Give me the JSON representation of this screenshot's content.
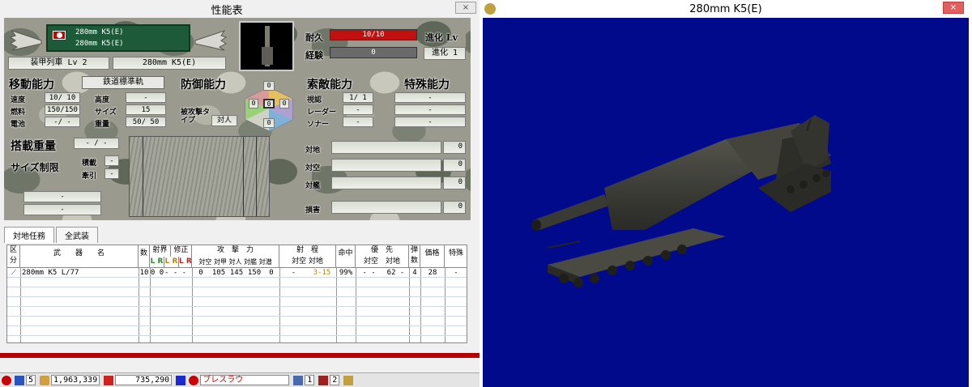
{
  "left_window": {
    "title": "性能表",
    "close_label": "⨯",
    "unit": {
      "name_line1": "280mm K5(E)",
      "name_line2": "280mm K5(E)",
      "class_level": "装甲列車 Lv 2",
      "name_field": "280mm K5(E)"
    },
    "durability": {
      "label": "耐久",
      "value": "10/10"
    },
    "experience": {
      "label": "経験",
      "value": "0"
    },
    "evolution": {
      "label": "進化 Lv",
      "value": "進化 1"
    },
    "mobility": {
      "title": "移動能力",
      "type_button": "鉄道標準軌",
      "rows": [
        {
          "label": "速度",
          "value": "10/ 10",
          "label2": "高度",
          "value2": "-"
        },
        {
          "label": "燃料",
          "value": "150/150",
          "label2": "サイズ",
          "value2": "15"
        },
        {
          "label": "電池",
          "value": "-/ -",
          "label2": "重量",
          "value2": "50/ 50"
        }
      ]
    },
    "defense": {
      "title": "防御能力",
      "attack_type_label": "被攻撃タイプ",
      "attack_type_value": "対人",
      "armor_top": "0",
      "armor_left": "0",
      "armor_center": "0",
      "armor_right": "0",
      "armor_bottom": "0"
    },
    "search": {
      "title": "索敵能力",
      "rows": [
        {
          "label": "視認",
          "value": "1/ 1"
        },
        {
          "label": "レーダー",
          "value": "-"
        },
        {
          "label": "ソナー",
          "value": "-"
        }
      ]
    },
    "special": {
      "title": "特殊能力",
      "values": [
        "-",
        "-",
        "-"
      ]
    },
    "cargo": {
      "title": "搭載重量",
      "value": "- / -",
      "size_limit_title": "サイズ制限",
      "load_label": "積載",
      "load_value": "-",
      "tow_label": "牽引",
      "tow_value": "-",
      "bottom_values": [
        "-",
        "-"
      ]
    },
    "combat_values": [
      {
        "label": "対地",
        "value": "0"
      },
      {
        "label": "対空",
        "value": "0"
      },
      {
        "label": "対艦",
        "value": "0"
      },
      {
        "label": "損害",
        "value": "0"
      }
    ],
    "tabs": [
      "対地任務",
      "全武装"
    ],
    "weapon_table": {
      "headers": {
        "kubun": "区分",
        "weapon": "武　　器　　名",
        "count": "数",
        "shakai": "射界",
        "shusei": "修正",
        "lr1": "L R",
        "lr2": "L R",
        "lr3": "L R",
        "attack": "攻　撃　力",
        "attack_sub": "対空 対甲 対人 対艦 対潜",
        "range": "射　程",
        "range_sub": "対空 対地",
        "accuracy": "命中",
        "priority": "優　先",
        "priority_sub": "対空　対地",
        "ammo": "弾数",
        "price": "価格",
        "special": "特殊"
      },
      "rows": [
        {
          "icon": "shell-icon",
          "name": "280mm K5 L/77",
          "count": "10",
          "sk": "0 0",
          "fix": "- - - -",
          "aa": "0",
          "at": "105",
          "ap": "145",
          "as": "150",
          "asub": "0",
          "range_air": "-",
          "range_ground": "3-15",
          "accuracy": "99%",
          "pri_air": "- -",
          "pri_ground": "62 -",
          "ammo": "4",
          "price": "28",
          "special": "-"
        }
      ]
    }
  },
  "status_bar": {
    "count1": "5",
    "money": "1,963,339",
    "resource": "735,290",
    "city": "ブレスラウ",
    "num1": "1",
    "num2": "2"
  },
  "right_window": {
    "title": "280mm K5(E)",
    "close_label": "⨯"
  },
  "colors": {
    "scene_bg": "#020a8c",
    "durability_bar": "#c01010",
    "unit_banner": "#1d5a3a"
  }
}
